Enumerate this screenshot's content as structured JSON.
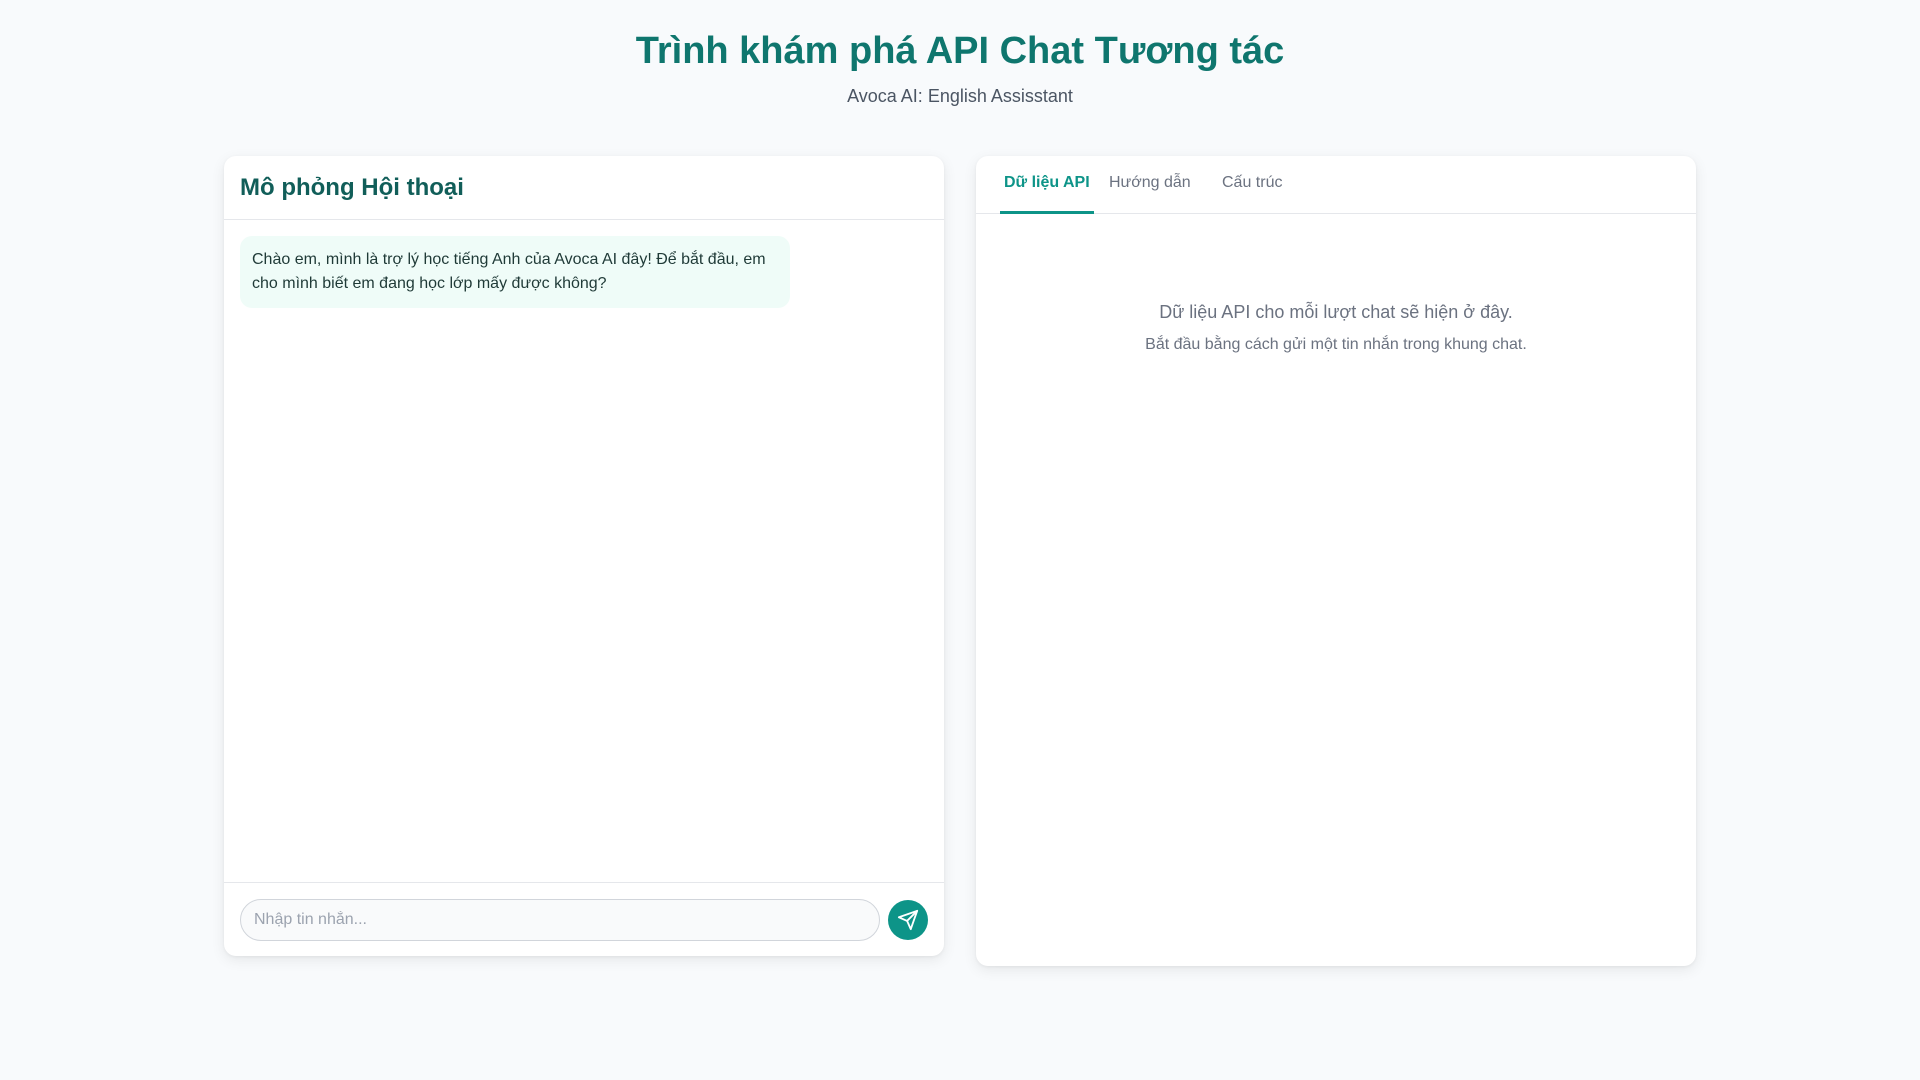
{
  "page": {
    "title": "Trình khám phá API Chat Tương tác",
    "subtitle": "Avoca AI: English Assisstant"
  },
  "chat": {
    "title": "Mô phỏng Hội thoại",
    "messages": [
      {
        "role": "assistant",
        "text": "Chào em, mình là trợ lý học tiếng Anh của Avoca AI đây! Để bắt đầu, em cho mình biết em đang học lớp mấy được không?"
      }
    ],
    "input": {
      "value": "",
      "placeholder": "Nhập tin nhắn..."
    },
    "send_icon": "send-icon"
  },
  "api_panel": {
    "tabs": [
      {
        "label": "Dữ liệu API",
        "active": true
      },
      {
        "label": "Hướng dẫn",
        "active": false
      },
      {
        "label": "Cấu trúc",
        "active": false
      }
    ],
    "empty_title": "Dữ liệu API cho mỗi lượt chat sẽ hiện ở đây.",
    "empty_hint": "Bắt đầu bằng cách gửi một tin nhắn trong khung chat."
  },
  "colors": {
    "accent": "#0d9488",
    "title": "#0f766e",
    "bot_bubble": "#effcf8",
    "background": "#f8fafc"
  }
}
